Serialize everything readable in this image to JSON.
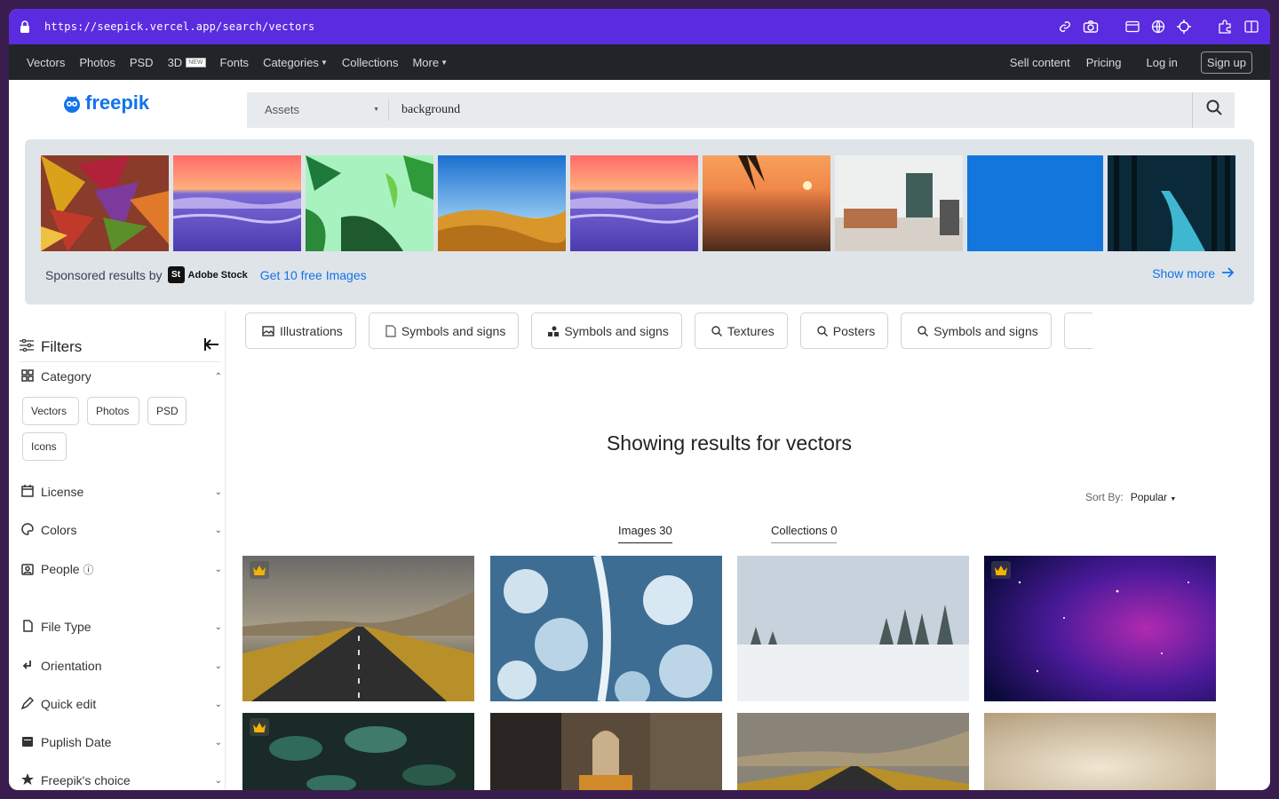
{
  "browser": {
    "url": "https://seepick.vercel.app/search/vectors"
  },
  "topnav": {
    "left": [
      {
        "label": "Vectors"
      },
      {
        "label": "Photos"
      },
      {
        "label": "PSD"
      },
      {
        "label": "3D",
        "badge": "NEW"
      },
      {
        "label": "Fonts"
      },
      {
        "label": "Categories",
        "caret": true
      },
      {
        "label": "Collections"
      },
      {
        "label": "More",
        "caret": true
      }
    ],
    "sell": "Sell content",
    "pricing": "Pricing",
    "login": "Log in",
    "signup": "Sign up"
  },
  "logo": "freepik",
  "search": {
    "scope": "Assets",
    "query": "background"
  },
  "sponsored": {
    "by_label": "Sponsored results by",
    "brand_mark": "St",
    "brand": "Adobe Stock",
    "cta": "Get 10 free Images",
    "show_more": "Show more"
  },
  "filters": {
    "title": "Filters",
    "category": "Category",
    "category_chips": [
      "Vectors",
      "Photos",
      "PSD",
      "Icons"
    ],
    "license": "License",
    "colors": "Colors",
    "people": "People",
    "file_type": "File Type",
    "orientation": "Orientation",
    "quick_edit": "Quick edit",
    "publish_date": "Puplish Date",
    "freepik_choice": "Freepik's choice"
  },
  "tags": [
    {
      "label": "Illustrations",
      "icon": "image-icon"
    },
    {
      "label": "Symbols and signs",
      "icon": "psd-file-icon"
    },
    {
      "label": "Symbols and signs",
      "icon": "shapes-icon"
    },
    {
      "label": "Textures",
      "icon": "search-icon"
    },
    {
      "label": "Posters",
      "icon": "search-icon"
    },
    {
      "label": "Symbols and signs",
      "icon": "search-icon"
    }
  ],
  "results": {
    "title": "Showing results for vectors",
    "sort_label": "Sort By:",
    "sort_value": "Popular",
    "tab_images": "Images 30",
    "tab_collections": "Collections 0"
  },
  "colors": {
    "accent": "#1273eb",
    "urlbar": "#5b2be0",
    "nav": "#212529",
    "premium": "#f4b400"
  }
}
